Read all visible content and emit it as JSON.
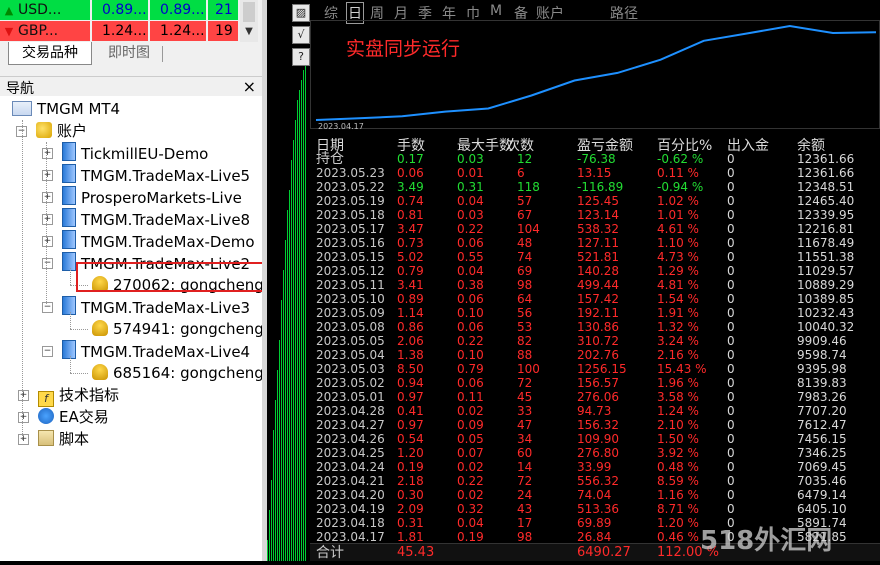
{
  "market_watch": [
    {
      "symbol": "USD...",
      "bid": "0.89...",
      "ask": "0.89...",
      "spread": "21",
      "direction": "up"
    },
    {
      "symbol": "GBP...",
      "bid": "1.24...",
      "ask": "1.24...",
      "spread": "19",
      "direction": "down"
    }
  ],
  "market_tabs": [
    "交易品种",
    "即时图"
  ],
  "navigator": {
    "title": "导航",
    "close": "×",
    "root": "TMGM MT4",
    "accounts_label": "账户",
    "servers": [
      {
        "name": "TickmillEU-Demo",
        "expanded": false
      },
      {
        "name": "TMGM.TradeMax-Live5",
        "expanded": false
      },
      {
        "name": "ProsperoMarkets-Live",
        "expanded": false
      },
      {
        "name": "TMGM.TradeMax-Live8",
        "expanded": false
      },
      {
        "name": "TMGM.TradeMax-Demo",
        "expanded": false
      },
      {
        "name": "TMGM.TradeMax-Live2",
        "expanded": true,
        "account": "270062: gongcheng"
      },
      {
        "name": "TMGM.TradeMax-Live3",
        "expanded": true,
        "account": "574941: gongcheng"
      },
      {
        "name": "TMGM.TradeMax-Live4",
        "expanded": true,
        "account": "685164: gongcheng"
      }
    ],
    "sections": [
      "技术指标",
      "EA交易",
      "脚本"
    ]
  },
  "toolbar_icons": [
    "chart-mode-icon",
    "check-icon",
    "help-icon"
  ],
  "report": {
    "tabs": [
      "综",
      "日",
      "周",
      "月",
      "季",
      "年",
      "巾",
      "M",
      "备",
      "账户",
      "路径"
    ],
    "active_tab": "日",
    "chart_caption": "实盘同步运行",
    "chart_start_date": "2023.04.17",
    "colors": {
      "growth_line": "#1e90ff",
      "profit": "#22dd33",
      "loss": "#ff2a2a"
    },
    "growth_series": [
      10889.29,
      10919.3,
      10950.51,
      11029.57,
      11082.0,
      11300.0,
      11551.38,
      11678.49,
      11900.0,
      12216.81,
      12339.95,
      12465.4,
      12348.51,
      12361.66
    ],
    "headers": [
      "日期",
      "手数",
      "最大手数",
      "次数",
      "盈亏金额",
      "百分比%",
      "出入金",
      "余额"
    ],
    "rows": [
      {
        "date": "持仓",
        "lots": "0.17",
        "max": "0.03",
        "count": "12",
        "pl": "-76.38",
        "pct": "-0.62 %",
        "io": "0",
        "bal": "12361.66",
        "tone": "pos"
      },
      {
        "date": "2023.05.23",
        "lots": "0.06",
        "max": "0.01",
        "count": "6",
        "pl": "13.15",
        "pct": "0.11 %",
        "io": "0",
        "bal": "12361.66",
        "tone": "neg"
      },
      {
        "date": "2023.05.22",
        "lots": "3.49",
        "max": "0.31",
        "count": "118",
        "pl": "-116.89",
        "pct": "-0.94 %",
        "io": "0",
        "bal": "12348.51",
        "tone": "pos"
      },
      {
        "date": "2023.05.19",
        "lots": "0.74",
        "max": "0.04",
        "count": "57",
        "pl": "125.45",
        "pct": "1.02 %",
        "io": "0",
        "bal": "12465.40",
        "tone": "neg"
      },
      {
        "date": "2023.05.18",
        "lots": "0.81",
        "max": "0.03",
        "count": "67",
        "pl": "123.14",
        "pct": "1.01 %",
        "io": "0",
        "bal": "12339.95",
        "tone": "neg"
      },
      {
        "date": "2023.05.17",
        "lots": "3.47",
        "max": "0.22",
        "count": "104",
        "pl": "538.32",
        "pct": "4.61 %",
        "io": "0",
        "bal": "12216.81",
        "tone": "neg"
      },
      {
        "date": "2023.05.16",
        "lots": "0.73",
        "max": "0.06",
        "count": "48",
        "pl": "127.11",
        "pct": "1.10 %",
        "io": "0",
        "bal": "11678.49",
        "tone": "neg"
      },
      {
        "date": "2023.05.15",
        "lots": "5.02",
        "max": "0.55",
        "count": "74",
        "pl": "521.81",
        "pct": "4.73 %",
        "io": "0",
        "bal": "11551.38",
        "tone": "neg"
      },
      {
        "date": "2023.05.12",
        "lots": "0.79",
        "max": "0.04",
        "count": "69",
        "pl": "140.28",
        "pct": "1.29 %",
        "io": "0",
        "bal": "11029.57",
        "tone": "neg"
      },
      {
        "date": "2023.05.11",
        "lots": "3.41",
        "max": "0.38",
        "count": "98",
        "pl": "499.44",
        "pct": "4.81 %",
        "io": "0",
        "bal": "10889.29",
        "tone": "neg"
      },
      {
        "date": "2023.05.10",
        "lots": "0.89",
        "max": "0.06",
        "count": "64",
        "pl": "157.42",
        "pct": "1.54 %",
        "io": "0",
        "bal": "10389.85",
        "tone": "neg"
      },
      {
        "date": "2023.05.09",
        "lots": "1.14",
        "max": "0.10",
        "count": "56",
        "pl": "192.11",
        "pct": "1.91 %",
        "io": "0",
        "bal": "10232.43",
        "tone": "neg"
      },
      {
        "date": "2023.05.08",
        "lots": "0.86",
        "max": "0.06",
        "count": "53",
        "pl": "130.86",
        "pct": "1.32 %",
        "io": "0",
        "bal": "10040.32",
        "tone": "neg"
      },
      {
        "date": "2023.05.05",
        "lots": "2.06",
        "max": "0.22",
        "count": "82",
        "pl": "310.72",
        "pct": "3.24 %",
        "io": "0",
        "bal": "9909.46",
        "tone": "neg"
      },
      {
        "date": "2023.05.04",
        "lots": "1.38",
        "max": "0.10",
        "count": "88",
        "pl": "202.76",
        "pct": "2.16 %",
        "io": "0",
        "bal": "9598.74",
        "tone": "neg"
      },
      {
        "date": "2023.05.03",
        "lots": "8.50",
        "max": "0.79",
        "count": "100",
        "pl": "1256.15",
        "pct": "15.43 %",
        "io": "0",
        "bal": "9395.98",
        "tone": "neg"
      },
      {
        "date": "2023.05.02",
        "lots": "0.94",
        "max": "0.06",
        "count": "72",
        "pl": "156.57",
        "pct": "1.96 %",
        "io": "0",
        "bal": "8139.83",
        "tone": "neg"
      },
      {
        "date": "2023.05.01",
        "lots": "0.97",
        "max": "0.11",
        "count": "45",
        "pl": "276.06",
        "pct": "3.58 %",
        "io": "0",
        "bal": "7983.26",
        "tone": "neg"
      },
      {
        "date": "2023.04.28",
        "lots": "0.41",
        "max": "0.02",
        "count": "33",
        "pl": "94.73",
        "pct": "1.24 %",
        "io": "0",
        "bal": "7707.20",
        "tone": "neg"
      },
      {
        "date": "2023.04.27",
        "lots": "0.97",
        "max": "0.09",
        "count": "47",
        "pl": "156.32",
        "pct": "2.10 %",
        "io": "0",
        "bal": "7612.47",
        "tone": "neg"
      },
      {
        "date": "2023.04.26",
        "lots": "0.54",
        "max": "0.05",
        "count": "34",
        "pl": "109.90",
        "pct": "1.50 %",
        "io": "0",
        "bal": "7456.15",
        "tone": "neg"
      },
      {
        "date": "2023.04.25",
        "lots": "1.20",
        "max": "0.07",
        "count": "60",
        "pl": "276.80",
        "pct": "3.92 %",
        "io": "0",
        "bal": "7346.25",
        "tone": "neg"
      },
      {
        "date": "2023.04.24",
        "lots": "0.19",
        "max": "0.02",
        "count": "14",
        "pl": "33.99",
        "pct": "0.48 %",
        "io": "0",
        "bal": "7069.45",
        "tone": "neg"
      },
      {
        "date": "2023.04.21",
        "lots": "2.18",
        "max": "0.22",
        "count": "72",
        "pl": "556.32",
        "pct": "8.59 %",
        "io": "0",
        "bal": "7035.46",
        "tone": "neg"
      },
      {
        "date": "2023.04.20",
        "lots": "0.30",
        "max": "0.02",
        "count": "24",
        "pl": "74.04",
        "pct": "1.16 %",
        "io": "0",
        "bal": "6479.14",
        "tone": "neg"
      },
      {
        "date": "2023.04.19",
        "lots": "2.09",
        "max": "0.32",
        "count": "43",
        "pl": "513.36",
        "pct": "8.71 %",
        "io": "0",
        "bal": "6405.10",
        "tone": "neg"
      },
      {
        "date": "2023.04.18",
        "lots": "0.31",
        "max": "0.04",
        "count": "17",
        "pl": "69.89",
        "pct": "1.20 %",
        "io": "0",
        "bal": "5891.74",
        "tone": "neg"
      },
      {
        "date": "2023.04.17",
        "lots": "1.81",
        "max": "0.19",
        "count": "98",
        "pl": "26.84",
        "pct": "0.46 %",
        "io": "0",
        "bal": "5821.85",
        "tone": "neg"
      }
    ],
    "total": {
      "label": "合计",
      "lots": "45.43",
      "pl": "6490.27",
      "pct": "112.00 %"
    }
  },
  "watermark": "518外汇网"
}
